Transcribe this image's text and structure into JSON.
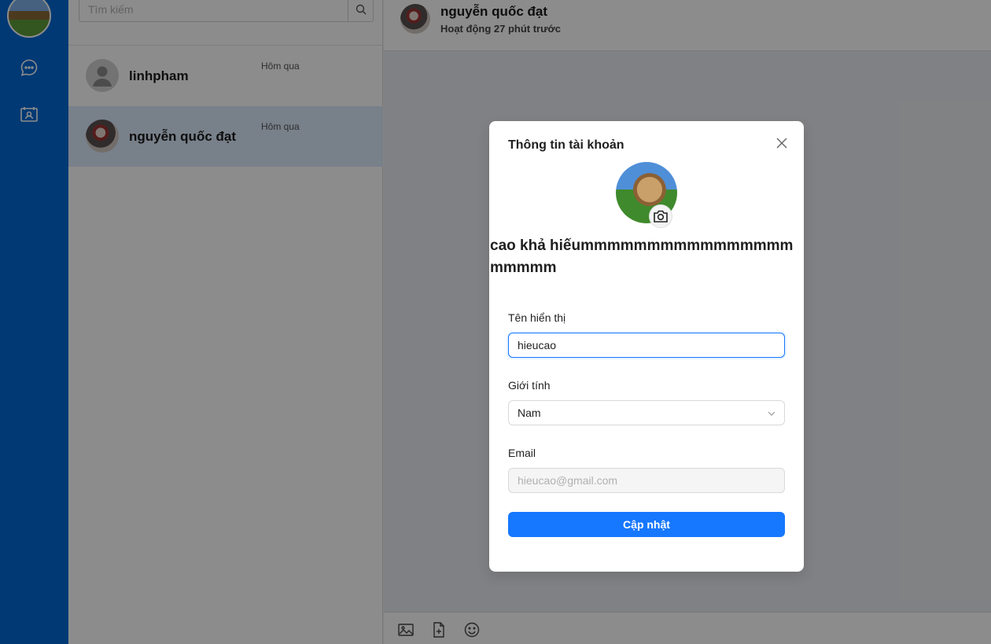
{
  "sidebar": {
    "items": [
      {
        "icon": "chat-bubble-icon"
      },
      {
        "icon": "contacts-book-icon"
      }
    ]
  },
  "search": {
    "placeholder": "Tìm kiếm",
    "icon": "search-icon"
  },
  "conversations": [
    {
      "name": "linhpham",
      "time": "Hôm qua",
      "avatar": "default-user-avatar"
    },
    {
      "name": "nguyễn quốc đạt",
      "time": "Hôm qua",
      "avatar": "photo-avatar",
      "active": true
    }
  ],
  "chat": {
    "title": "nguyễn quốc đạt",
    "status": "Hoạt động 27 phút trước",
    "toolbar": [
      {
        "icon": "image-icon"
      },
      {
        "icon": "file-icon"
      },
      {
        "icon": "emoji-icon"
      }
    ]
  },
  "modal": {
    "title": "Thông tin tài khoản",
    "display_name": "cao khả hiếummmmmmmmmmmmmmmmmmmmm",
    "fields": {
      "name_label": "Tên hiển thị",
      "name_value": "hieucao",
      "gender_label": "Giới tính",
      "gender_value": "Nam",
      "email_label": "Email",
      "email_value": "hieucao@gmail.com"
    },
    "submit_label": "Cập nhật"
  },
  "colors": {
    "rail": "#0068d4",
    "primary": "#1677ff",
    "active_row": "#dbe9fb"
  }
}
